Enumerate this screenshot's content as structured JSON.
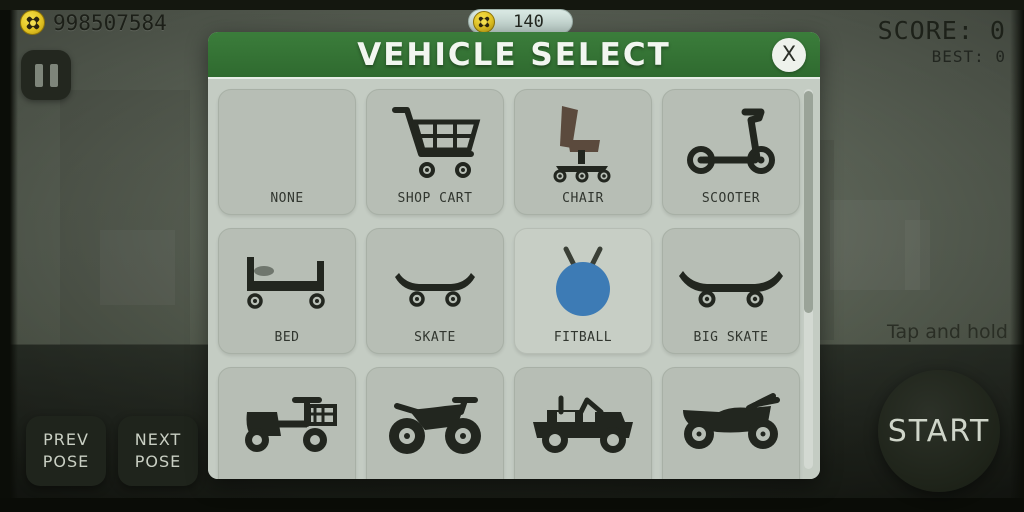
{
  "hud": {
    "currency_icon": "coin-icon",
    "currency_amount": "998507584",
    "pause_icon": "pause-icon",
    "coin_pill_amount": "140",
    "score_label": "SCORE: 0",
    "best_label": "BEST: 0"
  },
  "controls": {
    "prev_pose_line1": "PREV",
    "prev_pose_line2": "POSE",
    "next_pose_line1": "NEXT",
    "next_pose_line2": "POSE",
    "tap_and_hold": "Tap and hold",
    "start_label": "START"
  },
  "dialog": {
    "title": "VEHICLE SELECT",
    "close_label": "X",
    "vehicles": [
      {
        "label": "NONE",
        "icon": "none-icon",
        "selected": false
      },
      {
        "label": "SHOP CART",
        "icon": "shopping-cart-icon",
        "selected": false
      },
      {
        "label": "CHAIR",
        "icon": "office-chair-icon",
        "selected": false
      },
      {
        "label": "SCOOTER",
        "icon": "scooter-icon",
        "selected": false
      },
      {
        "label": "BED",
        "icon": "bed-icon",
        "selected": false
      },
      {
        "label": "SKATE",
        "icon": "skateboard-icon",
        "selected": false
      },
      {
        "label": "FITBALL",
        "icon": "fitball-icon",
        "selected": true
      },
      {
        "label": "BIG SKATE",
        "icon": "big-skateboard-icon",
        "selected": false
      },
      {
        "label": "",
        "icon": "moped-icon",
        "selected": false
      },
      {
        "label": "",
        "icon": "dirt-bike-icon",
        "selected": false
      },
      {
        "label": "",
        "icon": "jeep-icon",
        "selected": false
      },
      {
        "label": "",
        "icon": "atv-quad-icon",
        "selected": false
      }
    ]
  },
  "colors": {
    "header_green": "#2f6a2f",
    "panel_gray": "#c4ccc3",
    "tile_gray": "#b7beb5",
    "fitball_blue": "#3d7bb5",
    "chair_brown": "#5b4a3d",
    "coin_yellow": "#e3c423",
    "icon_dark": "#22261f"
  }
}
